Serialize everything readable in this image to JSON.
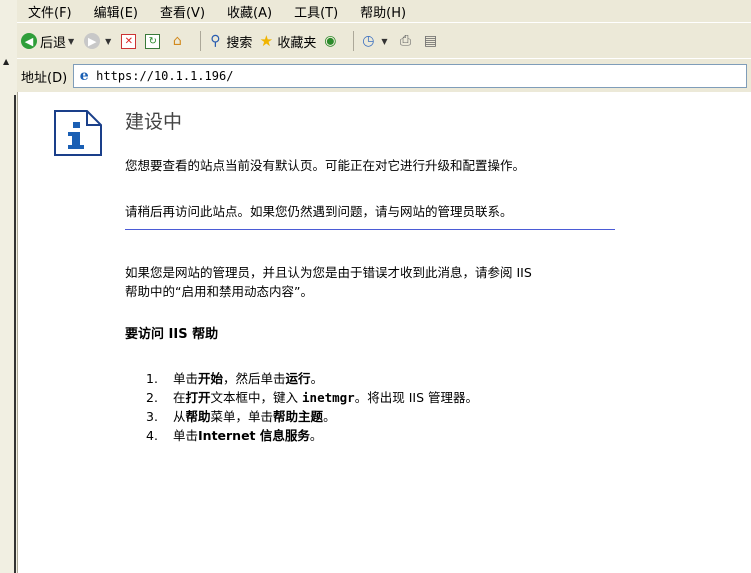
{
  "menu": {
    "items": [
      "文件(F)",
      "编辑(E)",
      "查看(V)",
      "收藏(A)",
      "工具(T)",
      "帮助(H)"
    ]
  },
  "toolbar": {
    "back_label": "后退",
    "search_label": "搜索",
    "favorites_label": "收藏夹"
  },
  "address": {
    "label": "地址(D)",
    "url": "https://10.1.1.196/"
  },
  "page": {
    "title": "建设中",
    "para1": "您想要查看的站点当前没有默认页。可能正在对它进行升级和配置操作。",
    "para2": "请稍后再访问此站点。如果您仍然遇到问题，请与网站的管理员联系。",
    "para3_line1": "如果您是网站的管理员，并且认为您是由于错误才收到此消息，请参阅 IIS",
    "para3_line2": "帮助中的“启用和禁用动态内容”。",
    "help_heading": "要访问 IIS 帮助",
    "steps": {
      "s1_num": "1.",
      "s1_a": "单击",
      "s1_b": "开始",
      "s1_c": "，然后单击",
      "s1_d": "运行",
      "s1_e": "。",
      "s2_num": "2.",
      "s2_a": "在",
      "s2_b": "打开",
      "s2_c": "文本框中，键入",
      "s2_d": "inetmgr",
      "s2_e": "。将出现 IIS 管理器。",
      "s3_num": "3.",
      "s3_a": "从",
      "s3_b": "帮助",
      "s3_c": "菜单，单击",
      "s3_d": "帮助主题",
      "s3_e": "。",
      "s4_num": "4.",
      "s4_a": "单击",
      "s4_b": "Internet 信息服务",
      "s4_c": "。"
    }
  },
  "colors": {
    "chrome_bg": "#ece9d8",
    "divider": "#4b5bd6",
    "icon_blue": "#1a5fb4"
  }
}
